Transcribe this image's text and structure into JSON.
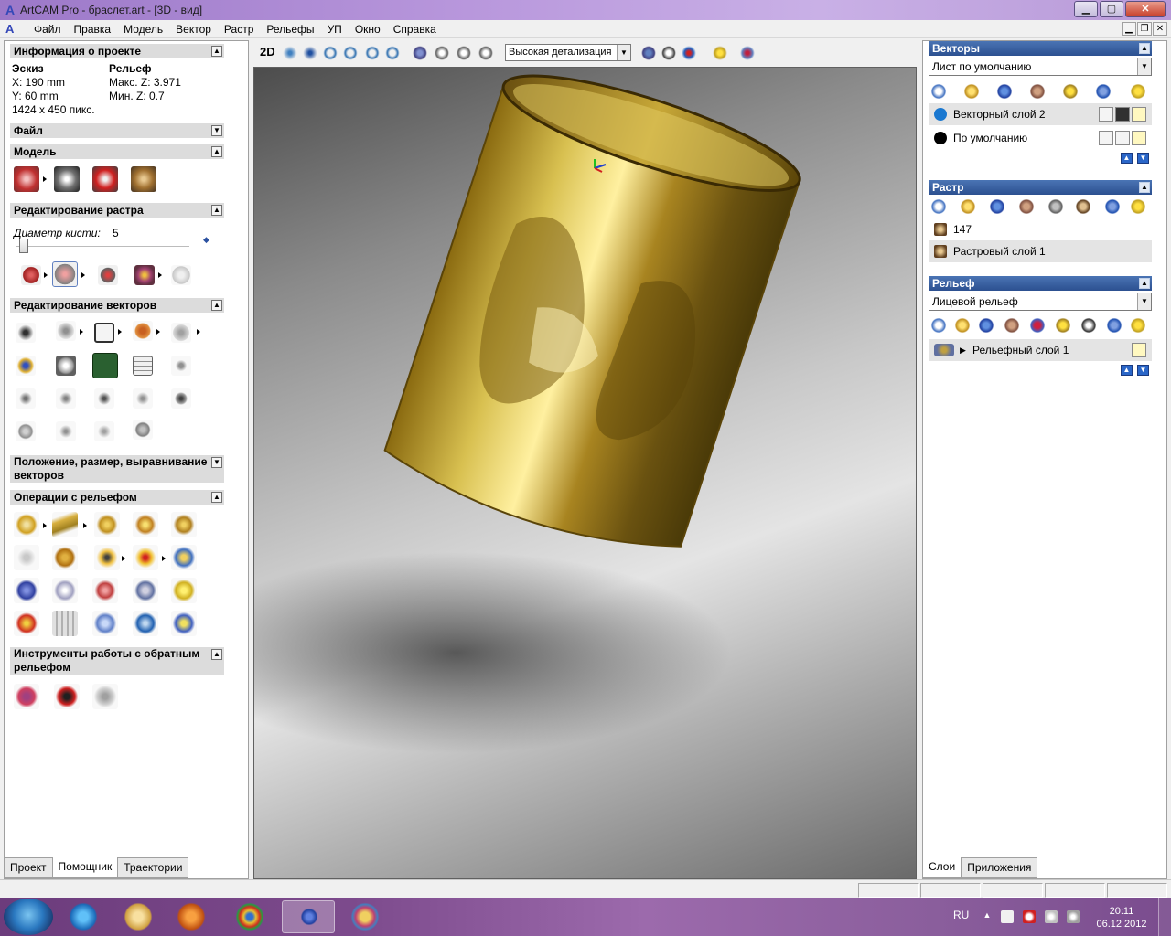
{
  "window": {
    "title": "ArtCAM Pro - браслет.art - [3D - вид]",
    "min": "▁",
    "max": "▢",
    "close": "✕"
  },
  "menu": [
    "Файл",
    "Правка",
    "Модель",
    "Вектор",
    "Растр",
    "Рельефы",
    "УП",
    "Окно",
    "Справка"
  ],
  "left": {
    "project_info": {
      "title": "Информация о проекте",
      "sketch_label": "Эскиз",
      "relief_label": "Рельеф",
      "x": "X: 190 mm",
      "y": "Y: 60 mm",
      "px": "1424 x 450 пикс.",
      "maxz": "Макс. Z: 3.971",
      "minz": "Мин. Z: 0.7"
    },
    "file_title": "Файл",
    "model_title": "Модель",
    "raster_edit": {
      "title": "Редактирование растра",
      "brush_label": "Диаметр кисти:",
      "brush_value": "5"
    },
    "vector_edit_title": "Редактирование векторов",
    "position_title": "Положение, размер, выравнивание векторов",
    "relief_ops_title": "Операции с рельефом",
    "reverse_title": "Инструменты работы с обратным рельефом",
    "tabs": [
      "Проект",
      "Помощник",
      "Траектории"
    ]
  },
  "view": {
    "mode_2d": "2D",
    "detail": "Высокая детализация"
  },
  "right": {
    "vectors": {
      "title": "Векторы",
      "sheet": "Лист по умолчанию",
      "layers": [
        "Векторный слой 2",
        "По умолчанию"
      ]
    },
    "raster": {
      "title": "Растр",
      "value": "147",
      "layer": "Растровый слой 1"
    },
    "relief": {
      "title": "Рельеф",
      "select": "Лицевой рельеф",
      "layer": "Рельефный слой 1"
    },
    "tabs": [
      "Слои",
      "Приложения"
    ]
  },
  "taskbar": {
    "lang": "RU",
    "time": "20:11",
    "date": "06.12.2012"
  },
  "colors": {
    "title_bar": "#b897dc",
    "panel_header": "#2c5090",
    "gold": "#b89a2a",
    "taskbar": "#7c4a8c"
  }
}
